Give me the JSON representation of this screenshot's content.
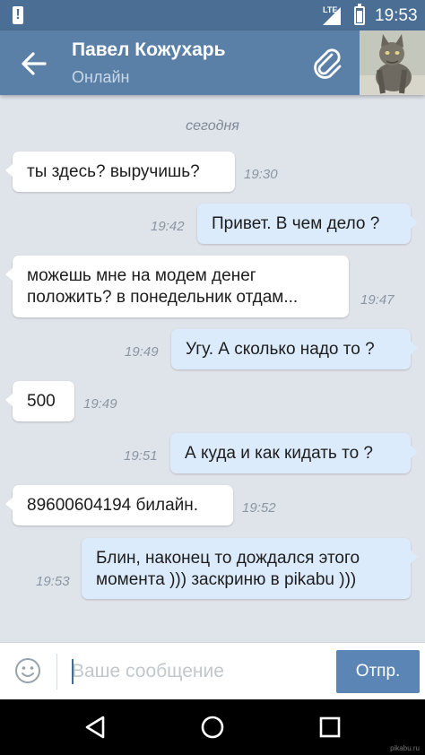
{
  "status_bar": {
    "network": "LTE",
    "time": "19:53",
    "warning_icon": "alert-icon"
  },
  "header": {
    "title": "Павел Кожухарь",
    "subtitle": "Онлайн",
    "back_icon": "arrow-back-icon",
    "attach_icon": "paperclip-icon",
    "avatar": "cat-avatar"
  },
  "chat": {
    "date_separator": "сегодня",
    "messages": [
      {
        "direction": "in",
        "text": "ты здесь? выручишь?",
        "time": "19:30"
      },
      {
        "direction": "out",
        "text": "Привет. В чем дело ?",
        "time": "19:42"
      },
      {
        "direction": "in",
        "text": "можешь мне на модем денег\nположить? в понедельник отдам...",
        "time": "19:47"
      },
      {
        "direction": "out",
        "text": "Угу. А сколько надо то ?",
        "time": "19:49"
      },
      {
        "direction": "in",
        "text": "500",
        "time": "19:49"
      },
      {
        "direction": "out",
        "text": "А куда и как кидать то ?",
        "time": "19:51"
      },
      {
        "direction": "in",
        "text": "89600604194 билайн.",
        "time": "19:52"
      },
      {
        "direction": "out",
        "text": "Блин, наконец то дождался этого\nмомента ))) заскриню в pikabu )))",
        "time": "19:53"
      }
    ]
  },
  "composer": {
    "placeholder": "Ваше сообщение",
    "value": "",
    "send_label": "Отпр.",
    "emoji_icon": "smiley-icon"
  },
  "nav_bar": {
    "back_icon": "triangle-back-icon",
    "home_icon": "circle-home-icon",
    "recents_icon": "square-recents-icon"
  },
  "watermark": "pikabu.ru",
  "colors": {
    "status_bar": "#4a6e94",
    "header": "#5b80a8",
    "background": "#dfe4ea",
    "incoming_bubble": "#ffffff",
    "outgoing_bubble": "#dcebfb",
    "send_button": "#5b85b5"
  }
}
